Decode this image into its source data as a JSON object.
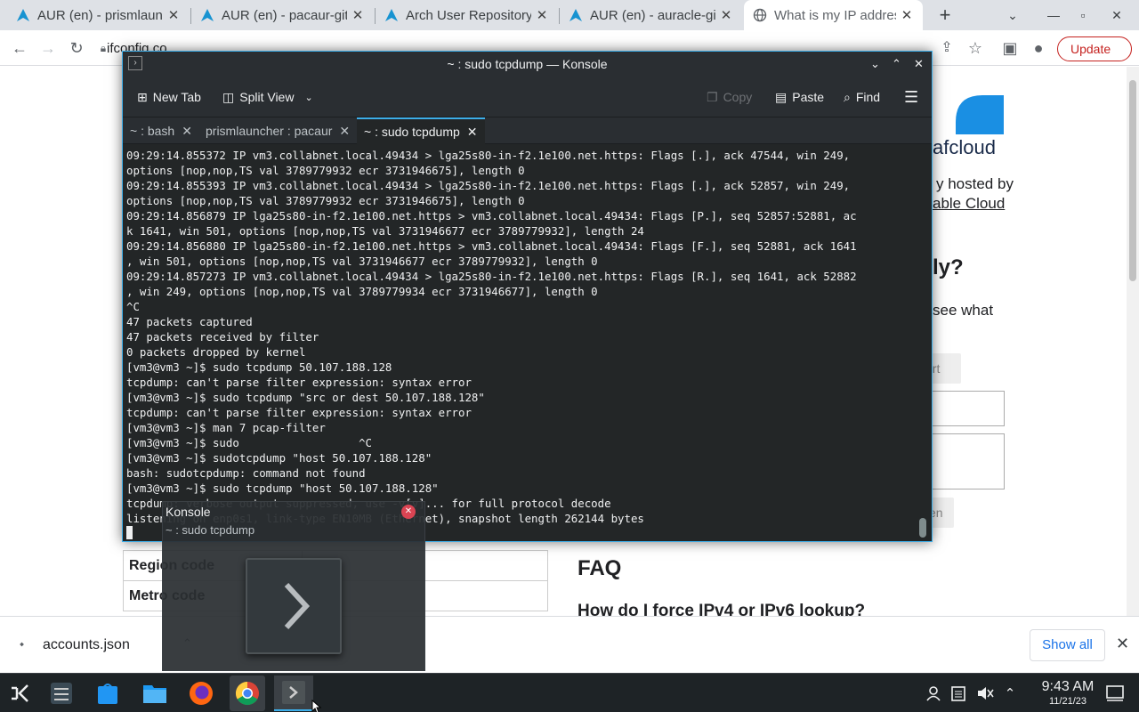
{
  "browser": {
    "tabs": [
      {
        "title": "AUR (en) - prismlaun",
        "icon": "arch-linux-icon"
      },
      {
        "title": "AUR (en) - pacaur-git",
        "icon": "arch-linux-icon"
      },
      {
        "title": "Arch User Repository",
        "icon": "arch-linux-icon"
      },
      {
        "title": "AUR (en) - auracle-git",
        "icon": "arch-linux-icon"
      },
      {
        "title": "What is my IP addres",
        "icon": "globe-icon"
      }
    ],
    "url": "ifconfig.co",
    "update_label": "Update"
  },
  "page": {
    "brand_suffix": "afcloud",
    "hosted_by": "y hosted by",
    "hosted_link": "able Cloud",
    "heading_suffix": "ly?",
    "see_what": "see what",
    "ort_button": "ort",
    "en_button": "en",
    "faq_heading": "FAQ",
    "faq_question": "How do I force IPv4 or IPv6 lookup?",
    "table_rows": [
      "Region code",
      "Metro code"
    ]
  },
  "downloads": {
    "file_name": "accounts.json",
    "show_all_label": "Show all"
  },
  "konsole": {
    "window_title": "~ : sudo tcpdump — Konsole",
    "toolbar": {
      "new_tab": "New Tab",
      "split_view": "Split View",
      "copy": "Copy",
      "paste": "Paste",
      "find": "Find"
    },
    "tabs": [
      "~ : bash",
      "prismlauncher : pacaur",
      "~ : sudo tcpdump"
    ],
    "terminal_lines": [
      "09:29:14.855372 IP vm3.collabnet.local.49434 > lga25s80-in-f2.1e100.net.https: Flags [.], ack 47544, win 249,",
      "options [nop,nop,TS val 3789779932 ecr 3731946675], length 0",
      "09:29:14.855393 IP vm3.collabnet.local.49434 > lga25s80-in-f2.1e100.net.https: Flags [.], ack 52857, win 249,",
      "options [nop,nop,TS val 3789779932 ecr 3731946675], length 0",
      "09:29:14.856879 IP lga25s80-in-f2.1e100.net.https > vm3.collabnet.local.49434: Flags [P.], seq 52857:52881, ac",
      "k 1641, win 501, options [nop,nop,TS val 3731946677 ecr 3789779932], length 24",
      "09:29:14.856880 IP lga25s80-in-f2.1e100.net.https > vm3.collabnet.local.49434: Flags [F.], seq 52881, ack 1641",
      ", win 501, options [nop,nop,TS val 3731946677 ecr 3789779932], length 0",
      "09:29:14.857273 IP vm3.collabnet.local.49434 > lga25s80-in-f2.1e100.net.https: Flags [R.], seq 1641, ack 52882",
      ", win 249, options [nop,nop,TS val 3789779934 ecr 3731946677], length 0",
      "^C",
      "47 packets captured",
      "47 packets received by filter",
      "0 packets dropped by kernel",
      "[vm3@vm3 ~]$ sudo tcpdump 50.107.188.128",
      "tcpdump: can't parse filter expression: syntax error",
      "[vm3@vm3 ~]$ sudo tcpdump \"src or dest 50.107.188.128\"",
      "tcpdump: can't parse filter expression: syntax error",
      "[vm3@vm3 ~]$ man 7 pcap-filter",
      "[vm3@vm3 ~]$ sudo                  ^C",
      "[vm3@vm3 ~]$ sudotcpdump \"host 50.107.188.128\"",
      "bash: sudotcpdump: command not found",
      "[vm3@vm3 ~]$ sudo tcpdump \"host 50.107.188.128\"",
      "tcpdump: verbose output suppressed, use -v[v]... for full protocol decode",
      "listening on enp0s1, link-type EN10MB (Ethernet), snapshot length 262144 bytes"
    ]
  },
  "preview": {
    "app_name": "Konsole",
    "window_title": "~ : sudo tcpdump"
  },
  "taskbar": {
    "time": "9:43 AM",
    "date": "11/21/23"
  },
  "colors": {
    "konsole_bg": "#232627",
    "accent": "#3daee9",
    "update_red": "#c5221f"
  }
}
